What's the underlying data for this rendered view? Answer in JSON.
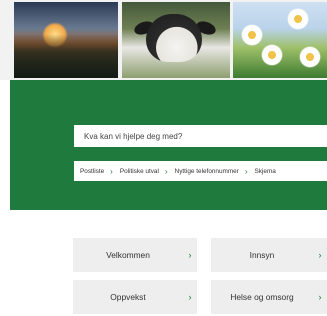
{
  "hero": {
    "search_placeholder": "Kva kan vi hjelpe deg med?",
    "quick_links": [
      {
        "label": "Postliste"
      },
      {
        "label": "Politiske utval"
      },
      {
        "label": "Nyttige telefonnummer"
      },
      {
        "label": "Skjema"
      }
    ]
  },
  "tiles": [
    {
      "label": "Velkommen"
    },
    {
      "label": "Innsyn"
    },
    {
      "label": "Oppvekst"
    },
    {
      "label": "Helse og omsorg"
    }
  ],
  "icons": {
    "chevron": "›",
    "chevron_icon_name": "chevron-right-icon"
  },
  "colors": {
    "brand_green": "#1f7a3d",
    "tile_bg": "#eeeeee"
  }
}
